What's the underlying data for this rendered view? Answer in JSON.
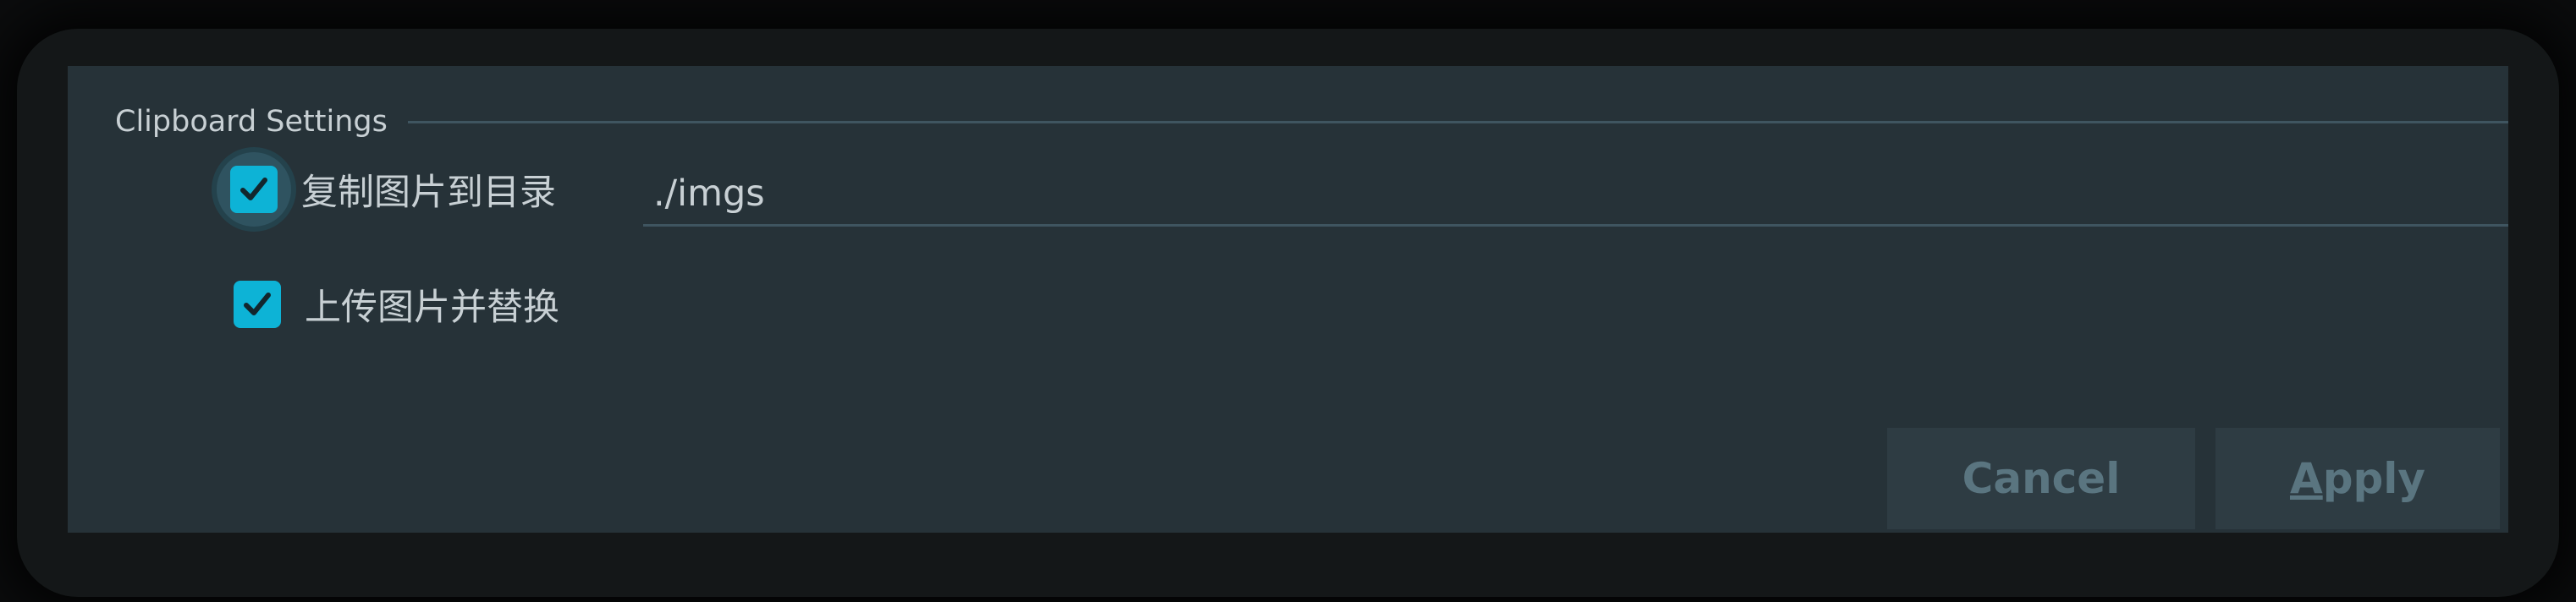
{
  "section": {
    "title": "Clipboard Settings"
  },
  "options": [
    {
      "label": "复制图片到目录",
      "checked": true
    },
    {
      "label": "上传图片并替换",
      "checked": true
    }
  ],
  "path_field": {
    "value": "./imgs"
  },
  "buttons": {
    "cancel": "Cancel",
    "apply_mnemonic": "A",
    "apply_rest": "pply"
  },
  "colors": {
    "background": "#263238",
    "accent": "#0db3d6",
    "text": "#c8d0d4",
    "button_text": "#5a7580"
  }
}
